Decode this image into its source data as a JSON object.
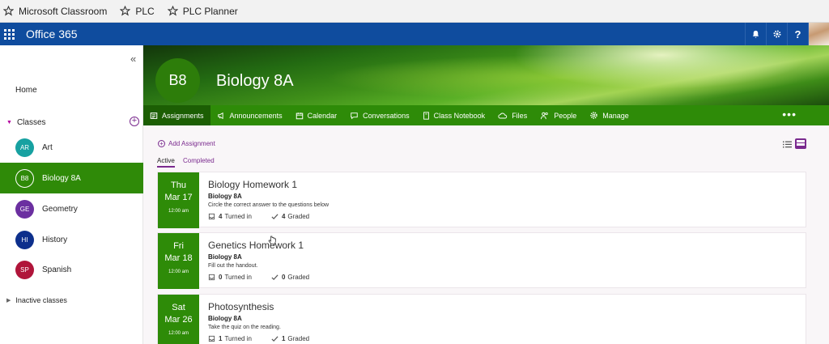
{
  "bookmarks": [
    {
      "label": "Microsoft Classroom"
    },
    {
      "label": "PLC"
    },
    {
      "label": "PLC Planner"
    }
  ],
  "suite_bar": {
    "title": "Office 365",
    "help_label": "?"
  },
  "sidebar": {
    "collapse_label": "«",
    "home_label": "Home",
    "classes_header": "Classes",
    "add_class_label": "+",
    "classes": [
      {
        "initials": "AR",
        "name": "Art",
        "color": "#17a1a1"
      },
      {
        "initials": "B8",
        "name": "Biology 8A",
        "color": "#2f8a08"
      },
      {
        "initials": "GE",
        "name": "Geometry",
        "color": "#6b2fa0"
      },
      {
        "initials": "HI",
        "name": "History",
        "color": "#0d2f8c"
      },
      {
        "initials": "SP",
        "name": "Spanish",
        "color": "#b0153a"
      }
    ],
    "active_class": "Biology 8A",
    "inactive_label": "Inactive classes"
  },
  "banner": {
    "initials": "B8",
    "title": "Biology 8A"
  },
  "class_nav": {
    "tabs": [
      {
        "label": "Assignments",
        "icon": "assignments-icon"
      },
      {
        "label": "Announcements",
        "icon": "megaphone-icon"
      },
      {
        "label": "Calendar",
        "icon": "calendar-icon"
      },
      {
        "label": "Conversations",
        "icon": "chat-icon"
      },
      {
        "label": "Class Notebook",
        "icon": "notebook-icon"
      },
      {
        "label": "Files",
        "icon": "cloud-icon"
      },
      {
        "label": "People",
        "icon": "people-icon"
      },
      {
        "label": "Manage",
        "icon": "gear-icon"
      }
    ],
    "active_tab": "Assignments",
    "more_label": "•••"
  },
  "assignments": {
    "add_label": "Add Assignment",
    "filter_tabs": [
      {
        "label": "Active"
      },
      {
        "label": "Completed"
      }
    ],
    "active_filter": "Active",
    "turned_in_suffix": "Turned in",
    "graded_suffix": "Graded",
    "items": [
      {
        "dow": "Thu",
        "date": "Mar 17",
        "time": "12:00 am",
        "title": "Biology Homework 1",
        "class": "Biology 8A",
        "description": "Circle the correct answer to the questions below",
        "turned_in": "4",
        "graded": "4"
      },
      {
        "dow": "Fri",
        "date": "Mar 18",
        "time": "12:00 am",
        "title": "Genetics Homework 1",
        "class": "Biology 8A",
        "description": "Fill out the handout.",
        "turned_in": "0",
        "graded": "0"
      },
      {
        "dow": "Sat",
        "date": "Mar 26",
        "time": "12:00 am",
        "title": "Photosynthesis",
        "class": "Biology 8A",
        "description": "Take the quiz on the reading.",
        "turned_in": "1",
        "graded": "1"
      }
    ]
  },
  "colors": {
    "suite_bar": "#0f4c9e",
    "class_green": "#2e8b08",
    "accent_purple": "#7a2a8e"
  }
}
